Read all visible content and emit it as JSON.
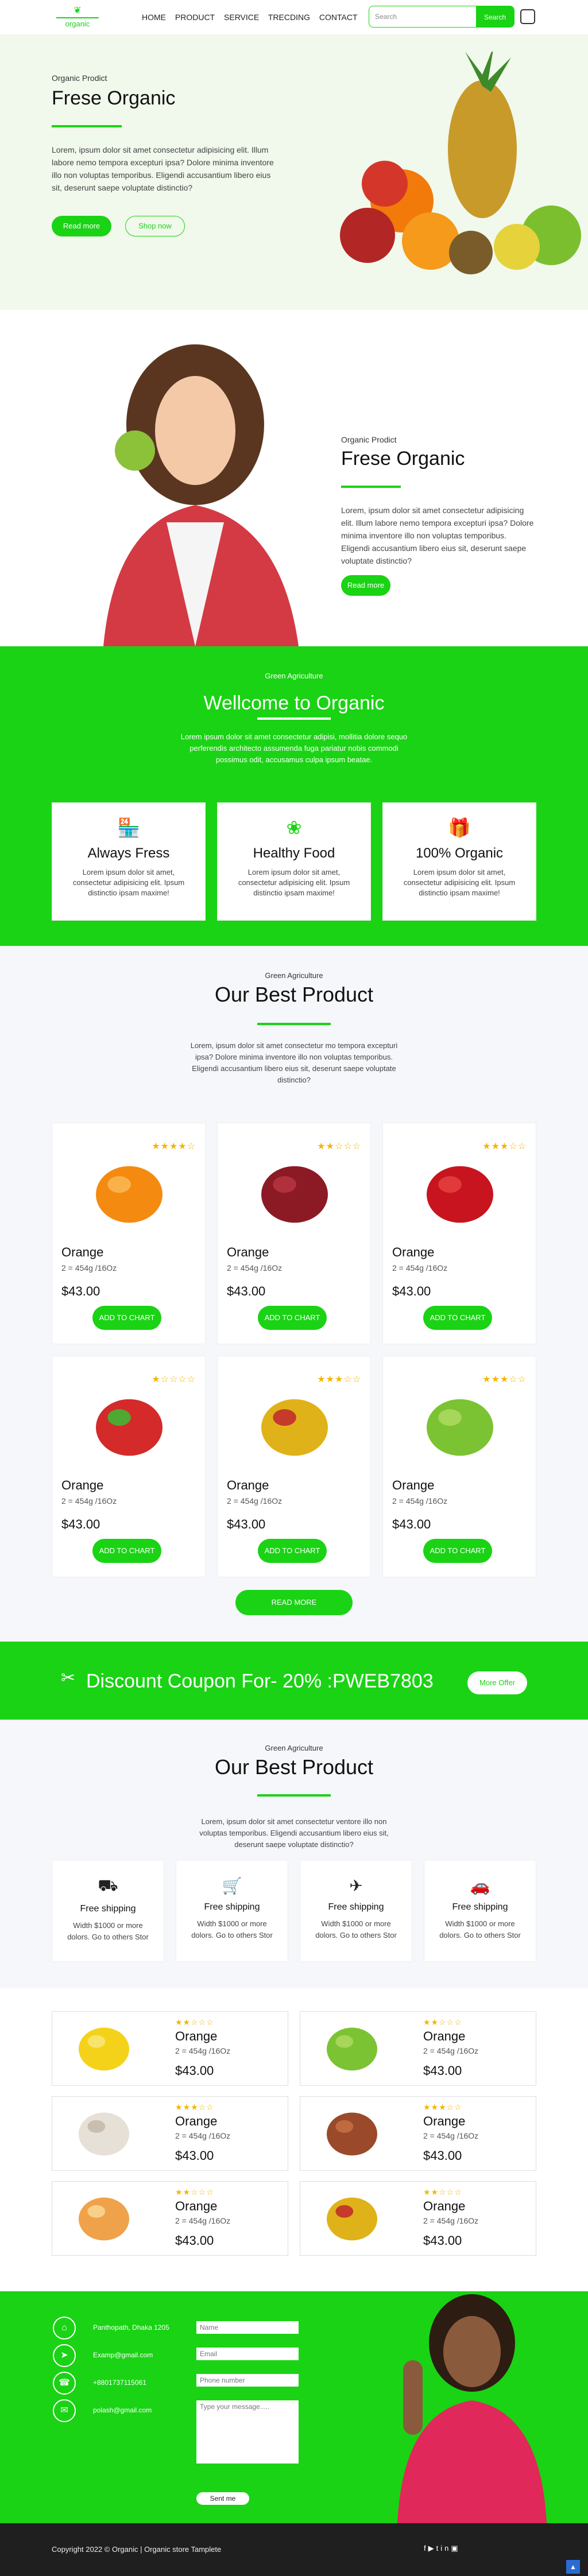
{
  "header": {
    "logo": "organic",
    "nav": [
      "HOME",
      "PRODUCT",
      "SERVICE",
      "TRECDING",
      "CONTACT"
    ],
    "search_placeholder": "Search",
    "search_button": "Search"
  },
  "hero1": {
    "eyebrow": "Organic Prodict",
    "title": "Frese Organic",
    "text": "Lorem, ipsum dolor sit amet consectetur adipisicing elit. Illum labore nemo tempora excepturi ipsa? Dolore minima inventore illo non voluptas temporibus. Eligendi accusantium libero eius sit, deserunt saepe voluptate distinctio?",
    "btn1": "Read more",
    "btn2": "Shop now"
  },
  "hero2": {
    "eyebrow": "Organic Prodict",
    "title": "Frese Organic",
    "text": "Lorem, ipsum dolor sit amet consectetur adipisicing elit. Illum labore nemo tempora excepturi ipsa? Dolore minima inventore illo non voluptas temporibus. Eligendi accusantium libero eius sit, deserunt saepe voluptate distinctio?",
    "btn": "Read more"
  },
  "welcome": {
    "eyebrow": "Green Agriculture",
    "title": "Wellcome to Organic",
    "text": "Lorem ipsum dolor sit amet consectetur adipisi, mollitia dolore sequo perferendis architecto assumenda fuga pariatur nobis commodi possimus odit, accusamus culpa ipsum beatae.",
    "features": [
      {
        "title": "Always Fress",
        "icon": "store-icon",
        "text": "Lorem ipsum dolor sit amet, consectetur adipisicing elit. Ipsum distinctio ipsam maxime!"
      },
      {
        "title": "Healthy Food",
        "icon": "flower-icon",
        "text": "Lorem ipsum dolor sit amet, consectetur adipisicing elit. Ipsum distinctio ipsam maxime!"
      },
      {
        "title": "100% Organic",
        "icon": "gift-icon",
        "text": "Lorem ipsum dolor sit amet, consectetur adipisicing elit. Ipsum distinctio ipsam maxime!"
      }
    ]
  },
  "products": {
    "eyebrow": "Green Agriculture",
    "title": "Our Best Product",
    "text": "Lorem, ipsum dolor sit amet consectetur mo tempora excepturi ipsa? Dolore minima inventore illo non voluptas temporibus. Eligendi accusantium libero eius sit, deserunt saepe voluptate distinctio?",
    "items": [
      {
        "name": "Orange",
        "weight": "2 = 454g /16Oz",
        "price": "$43.00",
        "rating": 4,
        "btn": "ADD TO CHART",
        "fruit": "orange"
      },
      {
        "name": "Orange",
        "weight": "2 = 454g /16Oz",
        "price": "$43.00",
        "rating": 2,
        "btn": "ADD TO CHART",
        "fruit": "pomegranate"
      },
      {
        "name": "Orange",
        "weight": "2 = 454g /16Oz",
        "price": "$43.00",
        "rating": 3,
        "btn": "ADD TO CHART",
        "fruit": "apple"
      },
      {
        "name": "Orange",
        "weight": "2 = 454g /16Oz",
        "price": "$43.00",
        "rating": 1,
        "btn": "ADD TO CHART",
        "fruit": "strawberry"
      },
      {
        "name": "Orange",
        "weight": "2 = 454g /16Oz",
        "price": "$43.00",
        "rating": 3,
        "btn": "ADD TO CHART",
        "fruit": "mango"
      },
      {
        "name": "Orange",
        "weight": "2 = 454g /16Oz",
        "price": "$43.00",
        "rating": 3,
        "btn": "ADD TO CHART",
        "fruit": "green apple"
      }
    ],
    "more": "READ MORE"
  },
  "coupon": {
    "text": "Discount Coupon For- 20% :PWEB7803",
    "btn": "More Offer"
  },
  "services": {
    "eyebrow": "Green Agriculture",
    "title": "Our Best Product",
    "text": "Lorem, ipsum dolor sit amet consectetur ventore illo non voluptas temporibus. Eligendi accusantium libero eius sit, deserunt saepe voluptate distinctio?",
    "items": [
      {
        "title": "Free shipping",
        "icon": "truck-icon",
        "text": "Width $1000 or more dolors. Go to others Stor"
      },
      {
        "title": "Free shipping",
        "icon": "cart-icon",
        "text": "Width $1000 or more dolors. Go to others Stor"
      },
      {
        "title": "Free shipping",
        "icon": "plane-icon",
        "text": "Width $1000 or more dolors. Go to others Stor"
      },
      {
        "title": "Free shipping",
        "icon": "car-icon",
        "text": "Width $1000 or more dolors. Go to others Stor"
      }
    ]
  },
  "list": {
    "items": [
      {
        "name": "Orange",
        "weight": "2 = 454g /16Oz",
        "price": "$43.00",
        "rating": 2,
        "fruit": "lemon"
      },
      {
        "name": "Orange",
        "weight": "2 = 454g /16Oz",
        "price": "$43.00",
        "rating": 2,
        "fruit": "green apple"
      },
      {
        "name": "Orange",
        "weight": "2 = 454g /16Oz",
        "price": "$43.00",
        "rating": 3,
        "fruit": "garlic"
      },
      {
        "name": "Orange",
        "weight": "2 = 454g /16Oz",
        "price": "$43.00",
        "rating": 3,
        "fruit": "onion"
      },
      {
        "name": "Orange",
        "weight": "2 = 454g /16Oz",
        "price": "$43.00",
        "rating": 2,
        "fruit": "melon"
      },
      {
        "name": "Orange",
        "weight": "2 = 454g /16Oz",
        "price": "$43.00",
        "rating": 2,
        "fruit": "mango"
      }
    ]
  },
  "contact": {
    "info": [
      "Panthopath, Dhaka 1205",
      "Examp@gmail.com",
      "+8801737115061",
      "polash@gmail.com"
    ],
    "form": {
      "name": "Name",
      "email": "Email",
      "phone": "Phone number",
      "message": "Type your message.....",
      "send": "Sent me"
    }
  },
  "footer": {
    "text": "Copyright 2022 © Organic | Organic store Tamplete"
  },
  "colors": {
    "green": "#1ad314",
    "star": "#f5b400"
  }
}
